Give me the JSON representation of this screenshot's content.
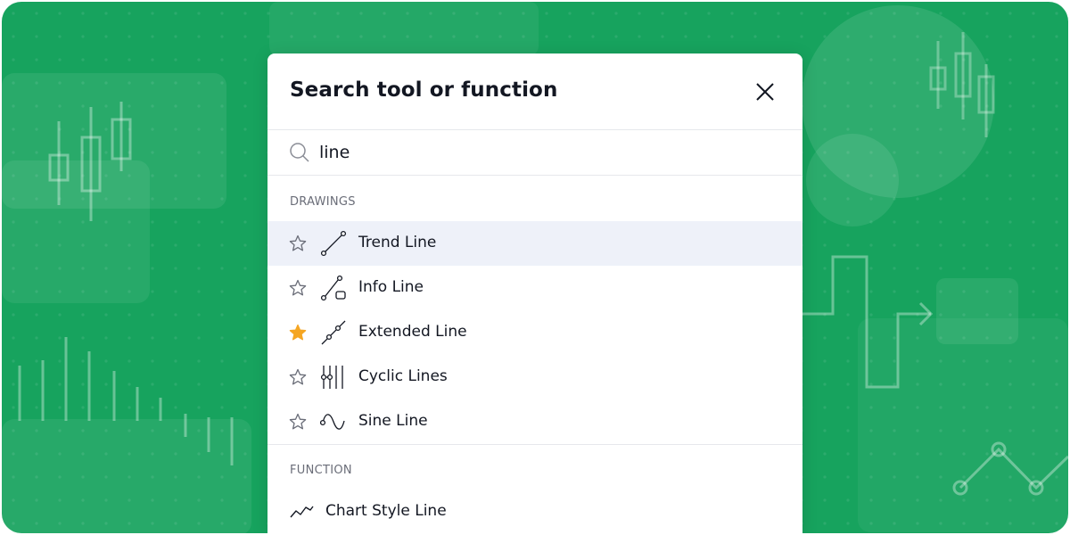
{
  "dialog": {
    "title": "Search tool or function",
    "close_icon": "close-icon"
  },
  "search": {
    "value": "line",
    "icon": "search-icon"
  },
  "drawings": {
    "header": "DRAWINGS",
    "items": [
      {
        "label": "Trend Line",
        "icon": "trend-line-icon",
        "favorite": false,
        "highlighted": true
      },
      {
        "label": "Info Line",
        "icon": "info-line-icon",
        "favorite": false,
        "highlighted": false
      },
      {
        "label": "Extended Line",
        "icon": "extended-line-icon",
        "favorite": true,
        "highlighted": false
      },
      {
        "label": "Cyclic Lines",
        "icon": "cyclic-lines-icon",
        "favorite": false,
        "highlighted": false
      },
      {
        "label": "Sine Line",
        "icon": "sine-line-icon",
        "favorite": false,
        "highlighted": false
      }
    ]
  },
  "function": {
    "header": "FUNCTION",
    "items": [
      {
        "label": "Chart Style Line",
        "icon": "chart-style-line-icon"
      }
    ]
  },
  "colors": {
    "background_green": "#17a35e",
    "favorite_star": "#f5a623",
    "highlight": "#eef1f9",
    "text": "#131722",
    "section_text": "#6a6d78"
  }
}
